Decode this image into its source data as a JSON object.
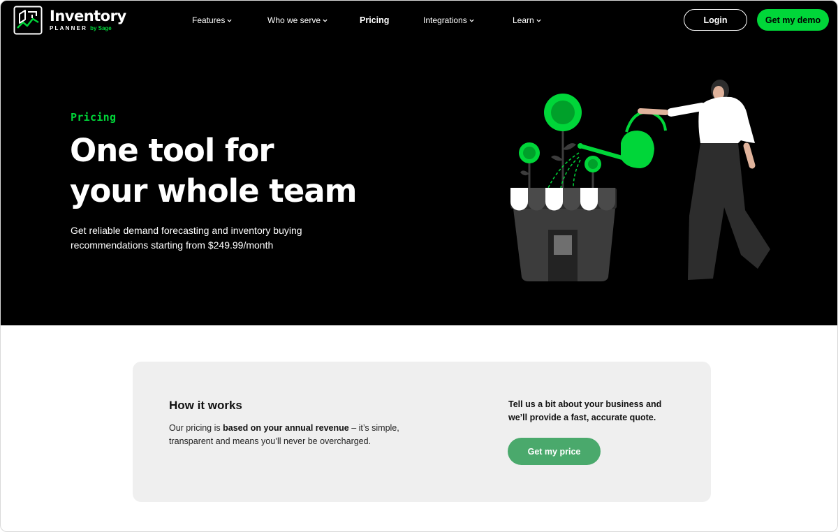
{
  "header": {
    "logo": {
      "name": "Inventory",
      "sub": "PLANNER",
      "by": "by Sage"
    },
    "nav": [
      {
        "label": "Features",
        "dropdown": true
      },
      {
        "label": "Who we serve",
        "dropdown": true
      },
      {
        "label": "Pricing",
        "dropdown": false,
        "active": true
      },
      {
        "label": "Integrations",
        "dropdown": true
      },
      {
        "label": "Learn",
        "dropdown": true
      }
    ],
    "login_label": "Login",
    "demo_label": "Get my demo"
  },
  "hero": {
    "eyebrow": "Pricing",
    "title_line1": "One tool for",
    "title_line2": "your whole team",
    "subtitle": "Get reliable demand forecasting and inventory buying recommendations starting from $249.99/month"
  },
  "how_it_works": {
    "title": "How it works",
    "body_prefix": "Our pricing is ",
    "body_bold": "based on your annual revenue",
    "body_suffix": " – it’s simple, transparent and means you’ll never be overcharged.",
    "quote_line1": "Tell us a bit about your business and",
    "quote_line2": "we’ll provide a fast, accurate quote.",
    "cta_label": "Get my price"
  },
  "colors": {
    "brand_green": "#00d639",
    "cta_green": "#4aa96c",
    "hero_bg": "#000000",
    "card_bg": "#efefef"
  },
  "icons": {
    "dropdown": "chevron-down-icon",
    "logo": "inventory-planner-logo-icon"
  }
}
